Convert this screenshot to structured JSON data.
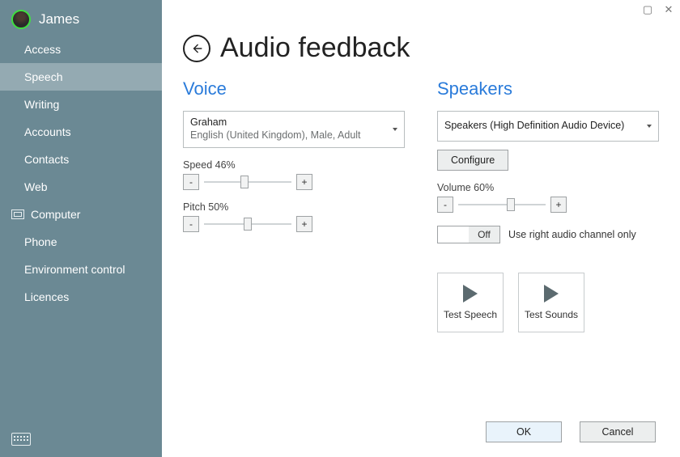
{
  "window": {
    "user_name": "James"
  },
  "sidebar": {
    "items": [
      {
        "label": "Access"
      },
      {
        "label": "Speech"
      },
      {
        "label": "Writing"
      },
      {
        "label": "Accounts"
      },
      {
        "label": "Contacts"
      },
      {
        "label": "Web"
      },
      {
        "label": "Computer"
      },
      {
        "label": "Phone"
      },
      {
        "label": "Environment control"
      },
      {
        "label": "Licences"
      }
    ],
    "selected_index": 1,
    "icon_index": 6
  },
  "header": {
    "title": "Audio feedback"
  },
  "voice": {
    "section_title": "Voice",
    "selected_name": "Graham",
    "selected_desc": "English (United Kingdom), Male, Adult",
    "speed_label": "Speed 46%",
    "speed_value": 46,
    "pitch_label": "Pitch 50%",
    "pitch_value": 50
  },
  "speakers": {
    "section_title": "Speakers",
    "selected_device": "Speakers (High Definition Audio Device)",
    "configure_label": "Configure",
    "volume_label": "Volume 60%",
    "volume_value": 60,
    "toggle_state": "Off",
    "toggle_text": "Use right audio channel only",
    "test_speech_label": "Test Speech",
    "test_sounds_label": "Test Sounds"
  },
  "footer": {
    "ok_label": "OK",
    "cancel_label": "Cancel"
  },
  "buttons": {
    "minus": "-",
    "plus": "+"
  }
}
